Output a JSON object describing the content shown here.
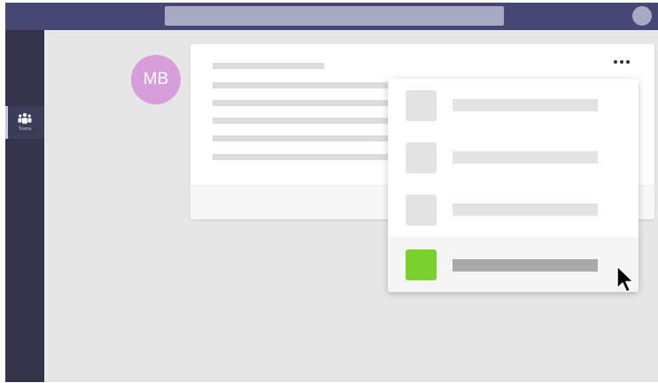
{
  "titlebar": {
    "search_placeholder": "",
    "colors": {
      "bar": "#464775",
      "search": "#a8a9c2"
    }
  },
  "rail": {
    "items": [
      {
        "label": "Teams",
        "icon": "teams-icon",
        "active": true
      }
    ]
  },
  "message": {
    "author_initials": "MB",
    "avatar_color": "#d89edb",
    "more_options_icon": "more-options-icon"
  },
  "menu": {
    "items": [
      {
        "icon_color": "#e3e3e3",
        "highlighted": false
      },
      {
        "icon_color": "#e3e3e3",
        "highlighted": false
      },
      {
        "icon_color": "#e3e3e3",
        "highlighted": false
      },
      {
        "icon_color": "#7ad12e",
        "highlighted": true
      }
    ]
  },
  "cursor": {
    "icon": "mouse-pointer-icon"
  }
}
